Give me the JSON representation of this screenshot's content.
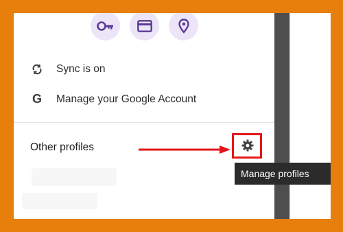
{
  "quick_actions": [
    {
      "icon": "key-icon",
      "name": "passwords"
    },
    {
      "icon": "credit-card-icon",
      "name": "payment-methods"
    },
    {
      "icon": "location-pin-icon",
      "name": "addresses"
    }
  ],
  "menu": {
    "sync_label": "Sync is on",
    "sync_icon": "sync-icon",
    "google_letter": "G",
    "manage_account_label": "Manage your Google Account",
    "other_profiles_label": "Other profiles",
    "gear_icon": "gear-icon"
  },
  "tooltip": {
    "text": "Manage profiles"
  },
  "colors": {
    "frame_border": "#e87e0c",
    "accent_circle": "#ece5f8",
    "accent_icon": "#5b3a94",
    "highlight": "#e3161a",
    "tooltip_bg": "#2b2b2b"
  }
}
